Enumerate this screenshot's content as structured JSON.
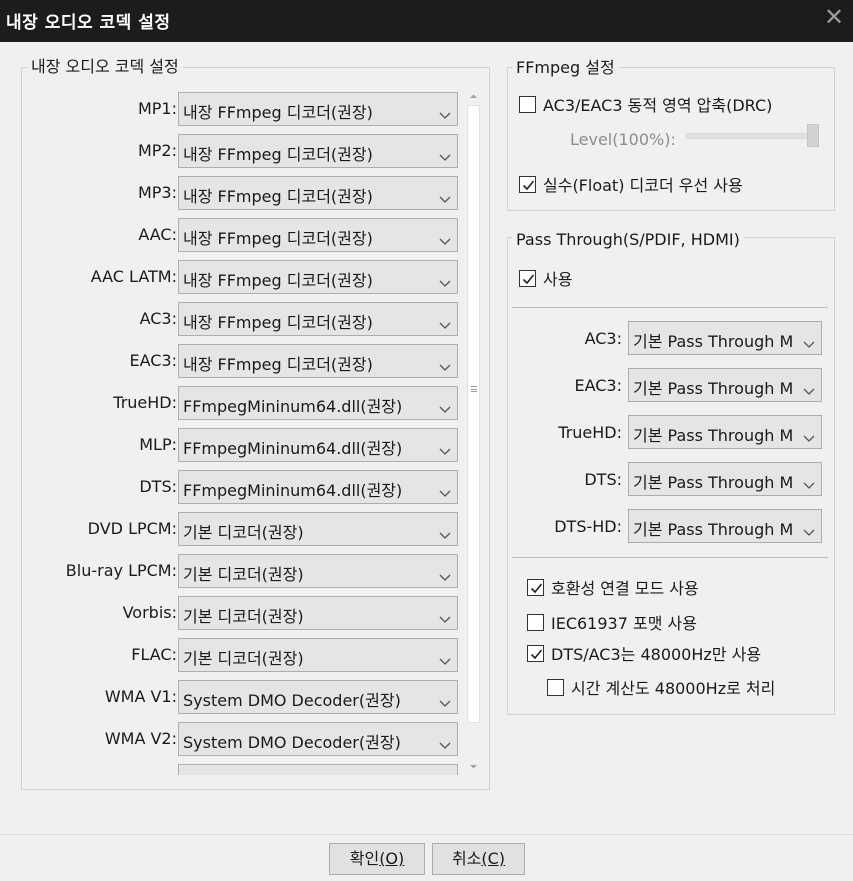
{
  "window": {
    "title": "내장 오디오 코덱 설정",
    "close_glyph": "✕"
  },
  "codec_group": {
    "label": "내장 오디오 코덱 설정",
    "rows": [
      {
        "label": "MP1:",
        "value": "내장 FFmpeg 디코더(권장)"
      },
      {
        "label": "MP2:",
        "value": "내장 FFmpeg 디코더(권장)"
      },
      {
        "label": "MP3:",
        "value": "내장 FFmpeg 디코더(권장)"
      },
      {
        "label": "AAC:",
        "value": "내장 FFmpeg 디코더(권장)"
      },
      {
        "label": "AAC LATM:",
        "value": "내장 FFmpeg 디코더(권장)"
      },
      {
        "label": "AC3:",
        "value": "내장 FFmpeg 디코더(권장)"
      },
      {
        "label": "EAC3:",
        "value": "내장 FFmpeg 디코더(권장)"
      },
      {
        "label": "TrueHD:",
        "value": "FFmpegMininum64.dll(권장)"
      },
      {
        "label": "MLP:",
        "value": "FFmpegMininum64.dll(권장)"
      },
      {
        "label": "DTS:",
        "value": "FFmpegMininum64.dll(권장)"
      },
      {
        "label": "DVD LPCM:",
        "value": "기본 디코더(권장)"
      },
      {
        "label": "Blu-ray LPCM:",
        "value": "기본 디코더(권장)"
      },
      {
        "label": "Vorbis:",
        "value": "기본 디코더(권장)"
      },
      {
        "label": "FLAC:",
        "value": "기본 디코더(권장)"
      },
      {
        "label": "WMA V1:",
        "value": "System DMO Decoder(권장)"
      },
      {
        "label": "WMA V2:",
        "value": "System DMO Decoder(권장)"
      },
      {
        "label": "",
        "value": ""
      }
    ]
  },
  "ffmpeg_group": {
    "label": "FFmpeg 설정",
    "drc_label": "AC3/EAC3 동적 영역 압축(DRC)",
    "drc_checked": false,
    "level_label": "Level(100%):",
    "level_value": 1.0,
    "float_label": "실수(Float) 디코더 우선 사용",
    "float_checked": true
  },
  "passthrough_group": {
    "label": "Pass Through(S/PDIF, HDMI)",
    "use_label": "사용",
    "use_checked": true,
    "rows": [
      {
        "label": "AC3:",
        "value": "기본 Pass Through M"
      },
      {
        "label": "EAC3:",
        "value": "기본 Pass Through M"
      },
      {
        "label": "TrueHD:",
        "value": "기본 Pass Through M"
      },
      {
        "label": "DTS:",
        "value": "기본 Pass Through M"
      },
      {
        "label": "DTS-HD:",
        "value": "기본 Pass Through M"
      }
    ],
    "options": [
      {
        "label": "호환성 연결 모드 사용",
        "checked": true
      },
      {
        "label": "IEC61937 포맷 사용",
        "checked": false
      },
      {
        "label": "DTS/AC3는 48000Hz만 사용",
        "checked": true
      },
      {
        "label": "시간 계산도 48000Hz로 처리",
        "checked": false
      }
    ]
  },
  "buttons": {
    "ok_label": "확인",
    "ok_key": "(O)",
    "cancel_label": "취소",
    "cancel_key": "(C)"
  }
}
